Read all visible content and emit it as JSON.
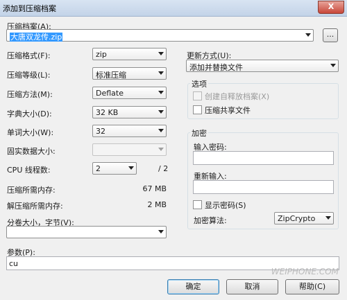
{
  "window": {
    "title": "添加到压缩档案",
    "close_glyph": "X"
  },
  "archive": {
    "label": "压缩档案(A):",
    "value": "大唐双龙传.zip",
    "browse_label": "..."
  },
  "format": {
    "label": "压缩格式(F):",
    "value": "zip"
  },
  "level": {
    "label": "压缩等级(L):",
    "value": "标准压缩"
  },
  "method": {
    "label": "压缩方法(M):",
    "value": "Deflate"
  },
  "dict": {
    "label": "字典大小(D):",
    "value": "32 KB"
  },
  "word": {
    "label": "单词大小(W):",
    "value": "32"
  },
  "solid": {
    "label": "固实数据大小:",
    "value": ""
  },
  "threads": {
    "label": "CPU 线程数:",
    "value": "2",
    "total": "/ 2"
  },
  "mem_compress": {
    "label": "压缩所需内存:",
    "value": "67 MB"
  },
  "mem_decompress": {
    "label": "解压缩所需内存:",
    "value": "2 MB"
  },
  "split": {
    "label": "分卷大小，字节(V):",
    "value": ""
  },
  "update": {
    "label": "更新方式(U):",
    "value": "添加并替换文件"
  },
  "options": {
    "title": "选项",
    "sfx_label": "创建自释放档案(X)",
    "shared_label": "压缩共享文件"
  },
  "encryption": {
    "title": "加密",
    "password_label": "输入密码:",
    "reenter_label": "重新输入:",
    "show_label": "显示密码(S)",
    "method_label": "加密算法:",
    "method_value": "ZipCrypto"
  },
  "params": {
    "label": "参数(P):",
    "value": "cu"
  },
  "buttons": {
    "ok": "确定",
    "cancel": "取消",
    "help": "帮助(C)"
  },
  "watermark": "WEIPHONE.COM"
}
